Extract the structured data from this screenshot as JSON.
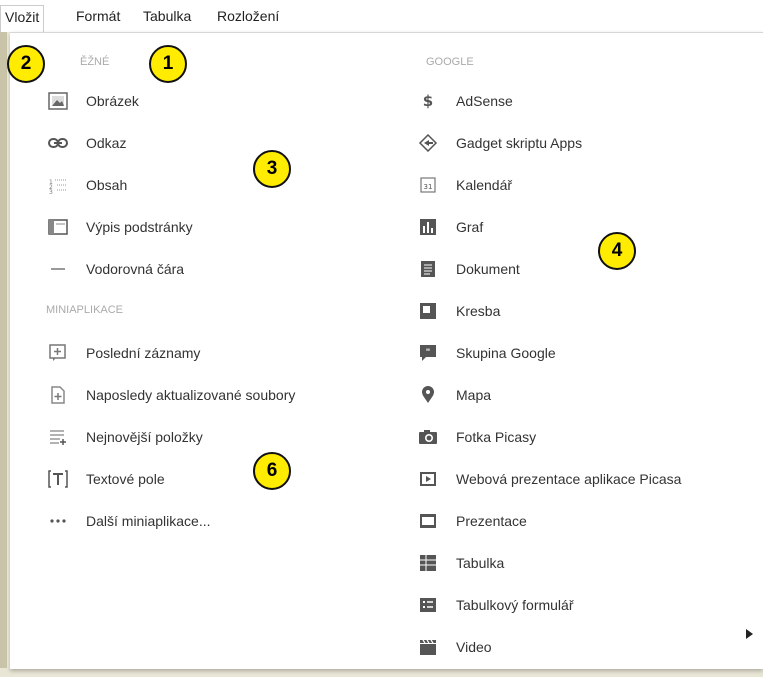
{
  "menubar": {
    "items": [
      "Vložit",
      "Formát",
      "Tabulka",
      "Rozložení"
    ]
  },
  "sections": {
    "common": "ĚŽNÉ",
    "gadgets": "MINIAPLIKACE",
    "google": "GOOGLE"
  },
  "left": {
    "common_items": [
      "Obrázek",
      "Odkaz",
      "Obsah",
      "Výpis podstránky",
      "Vodorovná čára"
    ],
    "gadget_items": [
      "Poslední záznamy",
      "Naposledy aktualizované soubory",
      "Nejnovější položky",
      "Textové pole",
      "Další miniaplikace..."
    ]
  },
  "right": {
    "google_items": [
      "AdSense",
      "Gadget skriptu Apps",
      "Kalendář",
      "Graf",
      "Dokument",
      "Kresba",
      "Skupina Google",
      "Mapa",
      "Fotka Picasy",
      "Webová prezentace aplikace Picasa",
      "Prezentace",
      "Tabulka",
      "Tabulkový formulář",
      "Video"
    ]
  },
  "icons": {
    "common": [
      "image-icon",
      "link-icon",
      "toc-icon",
      "subpage-list-icon",
      "horizontal-line-icon"
    ],
    "gadgets": [
      "recent-posts-icon",
      "recent-files-icon",
      "recent-items-icon",
      "text-box-icon",
      "more-dots-icon"
    ],
    "google": [
      "dollar-icon",
      "apps-script-icon",
      "calendar-icon",
      "chart-icon",
      "document-icon",
      "drawing-icon",
      "group-icon",
      "map-pin-icon",
      "camera-icon",
      "slideshow-icon",
      "presentation-icon",
      "spreadsheet-icon",
      "form-icon",
      "video-icon"
    ]
  },
  "callouts": [
    "2",
    "1",
    "3",
    "4",
    "6"
  ],
  "colors": {
    "callout_fill": "#ffec00",
    "section_text": "#aaaaaa",
    "item_text": "#333333"
  }
}
